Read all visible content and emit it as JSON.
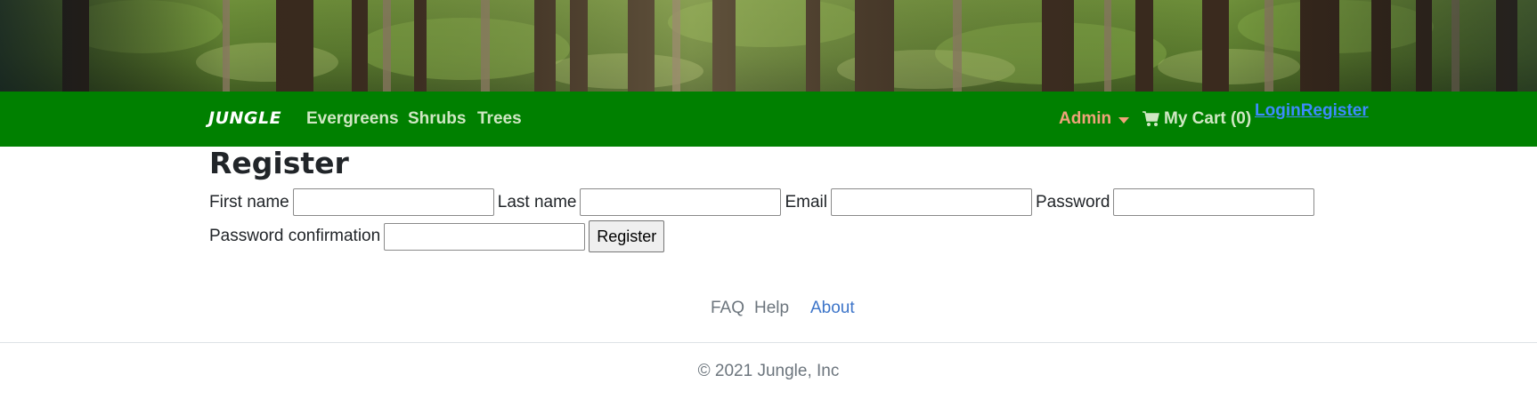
{
  "navbar": {
    "brand": "JUNGLE",
    "links": [
      {
        "label": "Evergreens"
      },
      {
        "label": "Shrubs"
      },
      {
        "label": "Trees"
      }
    ],
    "admin_label": "Admin",
    "cart_label": "My Cart (0)",
    "login_label": "Login",
    "register_label": "Register"
  },
  "page": {
    "title": "Register"
  },
  "form": {
    "first_name_label": "First name",
    "last_name_label": "Last name",
    "email_label": "Email",
    "password_label": "Password",
    "password_confirmation_label": "Password confirmation",
    "submit_label": "Register",
    "first_name_value": "",
    "last_name_value": "",
    "email_value": "",
    "password_value": "",
    "password_confirmation_value": ""
  },
  "footer": {
    "faq_label": "FAQ",
    "help_label": "Help",
    "about_label": "About",
    "copyright": "© 2021 Jungle, Inc"
  },
  "colors": {
    "navbar_bg": "#008000",
    "admin_color": "#f0a37a",
    "link_blue": "#3d8bfd",
    "footer_gray": "#6c757d"
  },
  "icons": {
    "cart": "shopping-cart-icon",
    "admin_dropdown": "caret-down-icon"
  }
}
